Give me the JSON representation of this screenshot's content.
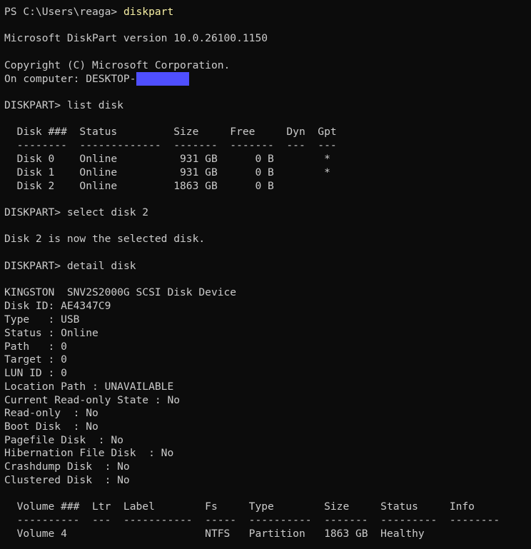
{
  "colors": {
    "background": "#0c0c0c",
    "text": "#cccccc",
    "command": "#f9f1a5",
    "redaction": "#4f4fff"
  },
  "session": {
    "prompt_ps": "PS C:\\Users\\reaga> ",
    "command_diskpart": "diskpart",
    "version": "Microsoft DiskPart version 10.0.26100.1150",
    "copyright": "Copyright (C) Microsoft Corporation.",
    "computer_prefix": "On computer: DESKTOP-",
    "prompt_diskpart": "DISKPART> "
  },
  "list_disk": {
    "command": "list disk",
    "header": "  Disk ###  Status         Size     Free     Dyn  Gpt",
    "separator": "  --------  -------------  -------  -------  ---  ---",
    "rows": [
      "  Disk 0    Online          931 GB      0 B        *",
      "  Disk 1    Online          931 GB      0 B        *",
      "  Disk 2    Online         1863 GB      0 B"
    ]
  },
  "select_disk": {
    "command": "select disk 2",
    "result": "Disk 2 is now the selected disk."
  },
  "detail_disk": {
    "command": "detail disk",
    "lines": [
      "KINGSTON  SNV2S2000G SCSI Disk Device",
      "Disk ID: AE4347C9",
      "Type   : USB",
      "Status : Online",
      "Path   : 0",
      "Target : 0",
      "LUN ID : 0",
      "Location Path : UNAVAILABLE",
      "Current Read-only State : No",
      "Read-only  : No",
      "Boot Disk  : No",
      "Pagefile Disk  : No",
      "Hibernation File Disk  : No",
      "Crashdump Disk  : No",
      "Clustered Disk  : No"
    ]
  },
  "volumes": {
    "header": "  Volume ###  Ltr  Label        Fs     Type        Size     Status     Info",
    "separator": "  ----------  ---  -----------  -----  ----------  -------  ---------  --------",
    "rows": [
      "  Volume 4                      NTFS   Partition   1863 GB  Healthy"
    ]
  }
}
